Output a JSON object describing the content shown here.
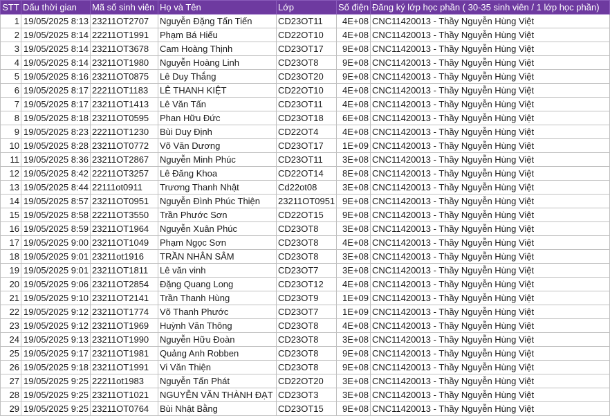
{
  "headers": [
    "STT",
    "Dấu thời gian",
    "Mã số sinh viên",
    "Họ và Tên",
    "Lớp",
    "Số điện",
    "Đăng ký lớp học phần ( 30-35 sinh viên / 1 lớp học phần)"
  ],
  "rows": [
    [
      "1",
      "19/05/2025 8:13",
      "23211OT2707",
      "Nguyễn Đặng Tấn Tiến",
      "CD23OT11",
      "4E+08",
      "CNC11420013 - Thầy Nguyễn Hùng Việt"
    ],
    [
      "2",
      "19/05/2025 8:14",
      "22211OT1991",
      "Phạm Bá Hiếu",
      "CD22OT10",
      "4E+08",
      "CNC11420013 - Thầy Nguyễn Hùng Việt"
    ],
    [
      "3",
      "19/05/2025 8:14",
      "23211OT3678",
      "Cam Hoàng Thịnh",
      "CD23OT17",
      "9E+08",
      "CNC11420013 - Thầy Nguyễn Hùng Việt"
    ],
    [
      "4",
      "19/05/2025 8:14",
      "23211OT1980",
      "Nguyễn Hoàng Linh",
      "CD23OT8",
      "9E+08",
      "CNC11420013 - Thầy Nguyễn Hùng Việt"
    ],
    [
      "5",
      "19/05/2025 8:16",
      "23211OT0875",
      "Lê Duy Thắng",
      "CD23OT20",
      "9E+08",
      "CNC11420013 - Thầy Nguyễn Hùng Việt"
    ],
    [
      "6",
      "19/05/2025 8:17",
      "22211OT1183",
      "LÊ THANH KIỆT",
      "CD22OT10",
      "4E+08",
      "CNC11420013 - Thầy Nguyễn Hùng Việt"
    ],
    [
      "7",
      "19/05/2025 8:17",
      "23211OT1413",
      "Lê Văn Tấn",
      "CD23OT11",
      "4E+08",
      "CNC11420013 - Thầy Nguyễn Hùng Việt"
    ],
    [
      "8",
      "19/05/2025 8:18",
      "23211OT0595",
      "Phan Hữu Đức",
      "CD23OT18",
      "6E+08",
      "CNC11420013 - Thầy Nguyễn Hùng Việt"
    ],
    [
      "9",
      "19/05/2025 8:23",
      "22211OT1230",
      "Bùi Duy Định",
      "CD22OT4",
      "4E+08",
      "CNC11420013 - Thầy Nguyễn Hùng Việt"
    ],
    [
      "10",
      "19/05/2025 8:28",
      "23211OT0772",
      "Võ Văn Dương",
      "CD23OT17",
      "1E+09",
      "CNC11420013 - Thầy Nguyễn Hùng Việt"
    ],
    [
      "11",
      "19/05/2025 8:36",
      "23211OT2867",
      "Nguyễn Minh Phúc",
      "CD23OT11",
      "3E+08",
      "CNC11420013 - Thầy Nguyễn Hùng Việt"
    ],
    [
      "12",
      "19/05/2025 8:42",
      "22211OT3257",
      "Lê Đăng Khoa",
      "CD22OT14",
      "8E+08",
      "CNC11420013 - Thầy Nguyễn Hùng Việt"
    ],
    [
      "13",
      "19/05/2025 8:44",
      "22111ot0911",
      "Trương Thanh Nhật",
      "Cd22ot08",
      "3E+08",
      "CNC11420013 - Thầy Nguyễn Hùng Việt"
    ],
    [
      "14",
      "19/05/2025 8:57",
      "23211OT0951",
      "Nguyễn Đình Phúc Thiện",
      "23211OT0951",
      "9E+08",
      "CNC11420013 - Thầy Nguyễn Hùng Việt"
    ],
    [
      "15",
      "19/05/2025 8:58",
      "22211OT3550",
      "Trần Phước Sơn",
      "CD22OT15",
      "9E+08",
      "CNC11420013 - Thầy Nguyễn Hùng Việt"
    ],
    [
      "16",
      "19/05/2025 8:59",
      "23211OT1964",
      "Nguyễn Xuân Phúc",
      "CD23OT8",
      "3E+08",
      "CNC11420013 - Thầy Nguyễn Hùng Việt"
    ],
    [
      "17",
      "19/05/2025 9:00",
      "23211OT1049",
      "Phạm Ngọc Sơn",
      "CD23OT8",
      "4E+08",
      "CNC11420013 - Thầy Nguyễn Hùng Việt"
    ],
    [
      "18",
      "19/05/2025 9:01",
      "23211ot1916",
      "TRẦN NHÂN SÂM",
      "CD23OT8",
      "3E+08",
      "CNC11420013 - Thầy Nguyễn Hùng Việt"
    ],
    [
      "19",
      "19/05/2025 9:01",
      "23211OT1811",
      "Lê văn vinh",
      "CD23OT7",
      "3E+08",
      "CNC11420013 - Thầy Nguyễn Hùng Việt"
    ],
    [
      "20",
      "19/05/2025 9:06",
      "23211OT2854",
      "Đặng Quang Long",
      "CD23OT12",
      "4E+08",
      "CNC11420013 - Thầy Nguyễn Hùng Việt"
    ],
    [
      "21",
      "19/05/2025 9:10",
      "23211OT2141",
      "Trần Thanh Hùng",
      "CD23OT9",
      "1E+09",
      "CNC11420013 - Thầy Nguyễn Hùng Việt"
    ],
    [
      "22",
      "19/05/2025 9:12",
      "23211OT1774",
      "Võ Thanh Phước",
      "CD23OT7",
      "1E+09",
      "CNC11420013 - Thầy Nguyễn Hùng Việt"
    ],
    [
      "23",
      "19/05/2025 9:12",
      "23211OT1969",
      "Huỳnh Văn Thông",
      "CD23OT8",
      "4E+08",
      "CNC11420013 - Thầy Nguyễn Hùng Việt"
    ],
    [
      "24",
      "19/05/2025 9:13",
      "23211OT1990",
      "Nguyễn Hữu Đoàn",
      "CD23OT8",
      "3E+08",
      "CNC11420013 - Thầy Nguyễn Hùng Việt"
    ],
    [
      "25",
      "19/05/2025 9:17",
      "23211OT1981",
      "Quảng Anh Robben",
      "CD23OT8",
      "9E+08",
      "CNC11420013 - Thầy Nguyễn Hùng Việt"
    ],
    [
      "26",
      "19/05/2025 9:18",
      "23211OT1991",
      "Vi Văn Thiện",
      "CD23OT8",
      "9E+08",
      "CNC11420013 - Thầy Nguyễn Hùng Việt"
    ],
    [
      "27",
      "19/05/2025 9:25",
      "22211ot1983",
      "Nguyễn Tấn Phát",
      "CD22OT20",
      "3E+08",
      "CNC11420013 - Thầy Nguyễn Hùng Việt"
    ],
    [
      "28",
      "19/05/2025 9:25",
      "23211OT1021",
      "NGUYỄN VĂN THÀNH ĐẠT",
      "CD23OT3",
      "3E+08",
      "CNC11420013 - Thầy Nguyễn Hùng Việt"
    ],
    [
      "29",
      "19/05/2025 9:25",
      "23211OT0764",
      "Bùi Nhật Bằng",
      "CD23OT15",
      "9E+08",
      "CNC11420013 - Thầy Nguyễn Hùng Việt"
    ]
  ],
  "colors": {
    "header_bg": "#6e3aa0",
    "header_text": "#ffffff",
    "grid": "#bfbfbf"
  }
}
